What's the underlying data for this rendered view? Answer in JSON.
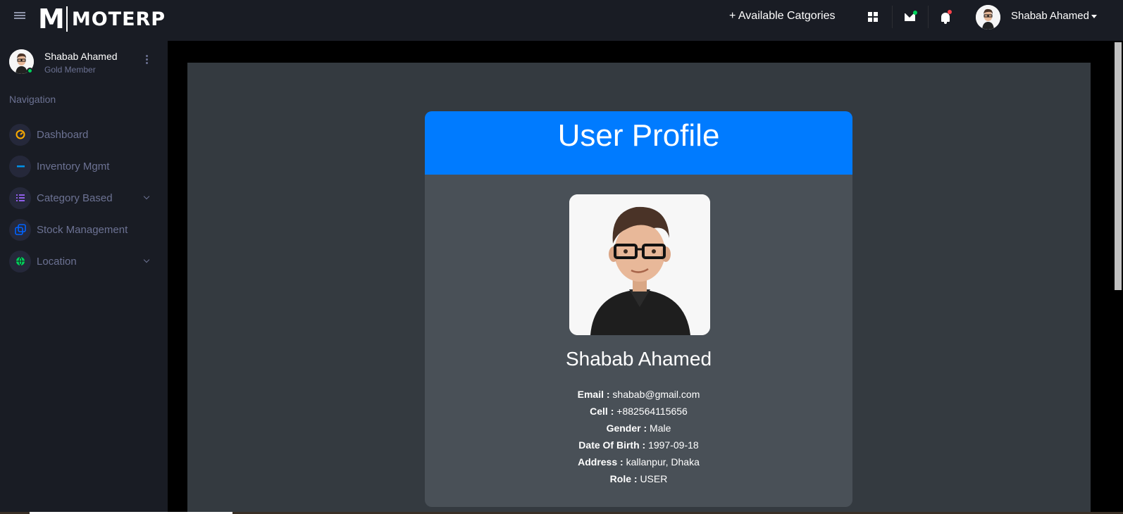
{
  "header": {
    "logo_letter": "M",
    "logo_text": "MOTERP",
    "categories_link": "+ Available Catgories",
    "user_name": "Shabab Ahamed"
  },
  "sidebar": {
    "user_name": "Shabab Ahamed",
    "user_role": "Gold Member",
    "nav_title": "Navigation",
    "items": [
      {
        "label": "Dashboard",
        "icon": "speedometer-icon",
        "color": "#ffab00"
      },
      {
        "label": "Inventory Mgmt",
        "icon": "minus-icon",
        "color": "#0090e7"
      },
      {
        "label": "Category Based",
        "icon": "list-icon",
        "color": "#8f5fe8"
      },
      {
        "label": "Stock Management",
        "icon": "copy-icon",
        "color": "#0062ff"
      },
      {
        "label": "Location",
        "icon": "globe-icon",
        "color": "#00d25b"
      }
    ]
  },
  "profile": {
    "title": "User Profile",
    "name": "Shabab Ahamed",
    "fields": [
      {
        "label": "Email :",
        "value": "shabab@gmail.com"
      },
      {
        "label": "Cell :",
        "value": "+882564115656"
      },
      {
        "label": "Gender :",
        "value": "Male"
      },
      {
        "label": "Date Of Birth :",
        "value": "1997-09-18"
      },
      {
        "label": "Address :",
        "value": "kallanpur, Dhaka"
      },
      {
        "label": "Role :",
        "value": "USER"
      }
    ]
  },
  "colors": {
    "accent": "#007bff",
    "sidebar_bg": "#191c24",
    "card_bg": "#495057"
  }
}
